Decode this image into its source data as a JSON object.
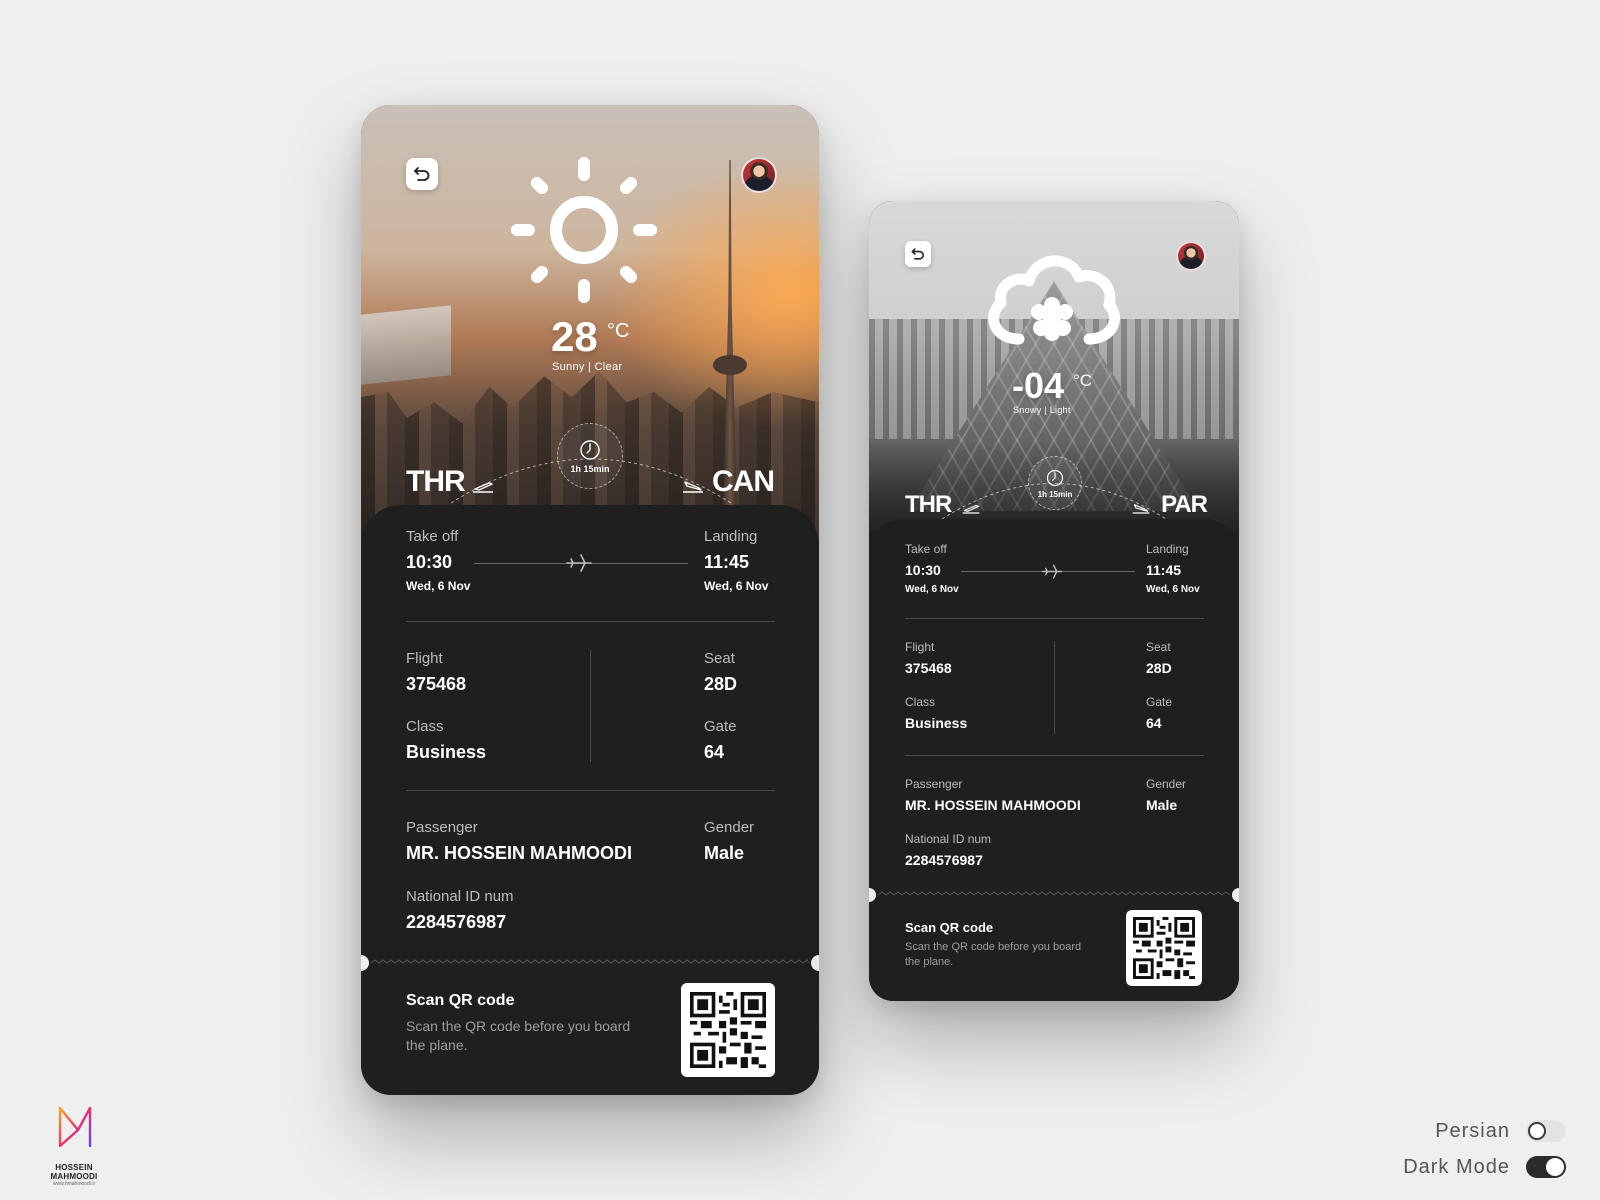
{
  "cards": [
    {
      "back_label": "Back",
      "weather": {
        "icon": "sun-icon",
        "temp": "28",
        "unit": "°C",
        "condition": "Sunny | Clear"
      },
      "route": {
        "from": "THR",
        "to": "CAN",
        "duration": "1h 15min"
      },
      "takeoff": {
        "label": "Take off",
        "time": "10:30",
        "date": "Wed, 6 Nov"
      },
      "landing": {
        "label": "Landing",
        "time": "11:45",
        "date": "Wed, 6 Nov"
      },
      "flight": {
        "label": "Flight",
        "value": "375468"
      },
      "seat": {
        "label": "Seat",
        "value": "28D"
      },
      "class": {
        "label": "Class",
        "value": "Business"
      },
      "gate": {
        "label": "Gate",
        "value": "64"
      },
      "passenger": {
        "label": "Passenger",
        "value": "MR. HOSSEIN MAHMOODI"
      },
      "gender": {
        "label": "Gender",
        "value": "Male"
      },
      "national_id": {
        "label": "National ID num",
        "value": "2284576987"
      },
      "qr": {
        "title": "Scan QR code",
        "desc": "Scan the QR code before you board the plane."
      }
    },
    {
      "back_label": "Back",
      "weather": {
        "icon": "snow-cloud-icon",
        "temp": "-04",
        "unit": "°C",
        "condition": "Snowy | Light"
      },
      "route": {
        "from": "THR",
        "to": "PAR",
        "duration": "1h 15min"
      },
      "takeoff": {
        "label": "Take off",
        "time": "10:30",
        "date": "Wed, 6 Nov"
      },
      "landing": {
        "label": "Landing",
        "time": "11:45",
        "date": "Wed, 6 Nov"
      },
      "flight": {
        "label": "Flight",
        "value": "375468"
      },
      "seat": {
        "label": "Seat",
        "value": "28D"
      },
      "class": {
        "label": "Class",
        "value": "Business"
      },
      "gate": {
        "label": "Gate",
        "value": "64"
      },
      "passenger": {
        "label": "Passenger",
        "value": "MR. HOSSEIN MAHMOODI"
      },
      "gender": {
        "label": "Gender",
        "value": "Male"
      },
      "national_id": {
        "label": "National ID num",
        "value": "2284576987"
      },
      "qr": {
        "title": "Scan QR code",
        "desc": "Scan the QR code before you board the plane."
      }
    }
  ],
  "settings": {
    "persian": {
      "label": "Persian",
      "on": false
    },
    "dark_mode": {
      "label": "Dark Mode",
      "on": true
    }
  },
  "brand": {
    "name": "HOSSEIN MAHMOODI",
    "url": "www.hmahmoodi.ir"
  },
  "colors": {
    "background": "#efefef",
    "card": "#1f1f1f",
    "text": "#ffffff",
    "muted": "#bdbdbd"
  }
}
